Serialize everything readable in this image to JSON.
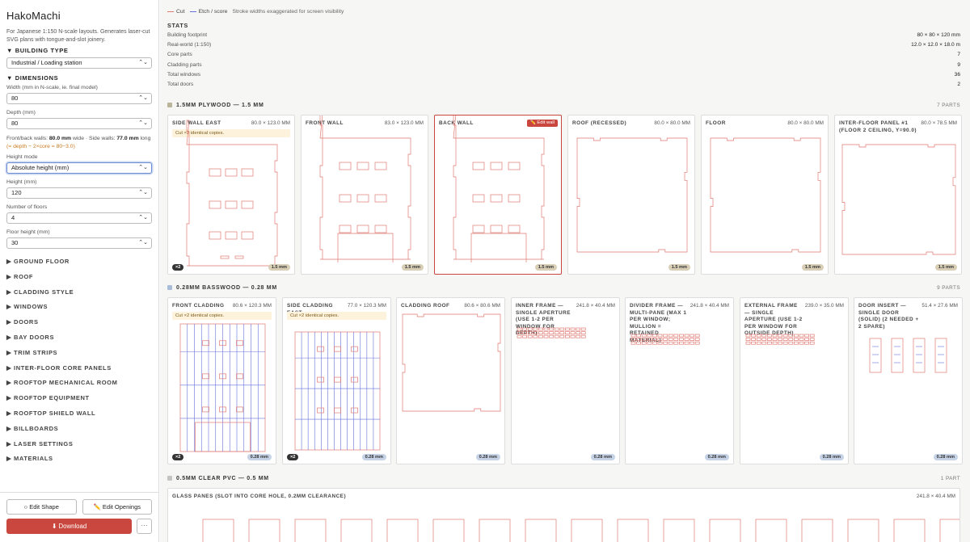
{
  "app": {
    "title": "HakoMachi",
    "description": "For Japanese 1:150 N-scale layouts. Generates laser-cut SVG plans with tongue-and-slot joinery."
  },
  "sidebar": {
    "building_type_label": "▼ BUILDING TYPE",
    "building_type_value": "Industrial / Loading station",
    "dimensions_label": "▼ DIMENSIONS",
    "width_label": "Width (mm in N-scale, ie. final model)",
    "width_value": "80",
    "depth_label": "Depth (mm)",
    "depth_value": "80",
    "walls_note_a": "Front/back walls: ",
    "walls_note_b": "80.0 mm",
    "walls_note_c": " wide · Side walls: ",
    "walls_note_d": "77.0 mm",
    "walls_note_e": " long ",
    "walls_note_f": "(= depth − 2×core = 80−3.0)",
    "height_mode_label": "Height mode",
    "height_mode_value": "Absolute height (mm)",
    "height_label": "Height (mm)",
    "height_value": "120",
    "floors_label": "Number of floors",
    "floors_value": "4",
    "floor_height_label": "Floor height (mm)",
    "floor_height_value": "30",
    "sections": [
      "▶ GROUND FLOOR",
      "▶ ROOF",
      "▶ CLADDING STYLE",
      "▶ WINDOWS",
      "▶ DOORS",
      "▶ BAY DOORS",
      "▶ TRIM STRIPS",
      "▶ INTER-FLOOR CORE PANELS",
      "▶ ROOFTOP MECHANICAL ROOM",
      "▶ ROOFTOP EQUIPMENT",
      "▶ ROOFTOP SHIELD WALL",
      "▶ BILLBOARDS",
      "▶ LASER SETTINGS",
      "▶ MATERIALS"
    ],
    "edit_shape": "○ Edit Shape",
    "edit_openings": "✏️ Edit Openings",
    "download": "⬇ Download",
    "more": "···"
  },
  "legend": {
    "cut": "Cut",
    "etch": "Etch / score",
    "hint": "Stroke widths exaggerated for screen visibility",
    "cut_color": "#e07a72",
    "etch_color": "#6670d8"
  },
  "stats": {
    "title": "STATS",
    "rows": [
      {
        "label": "Building footprint",
        "value": "80 × 80 × 120 mm"
      },
      {
        "label": "Real-world (1:150)",
        "value": "12.0 × 12.0 × 18.0 m"
      },
      {
        "label": "Core parts",
        "value": "7"
      },
      {
        "label": "Cladding parts",
        "value": "9"
      },
      {
        "label": "Total windows",
        "value": "36"
      },
      {
        "label": "Total doors",
        "value": "2"
      }
    ]
  },
  "groups": [
    {
      "title": "1.5MM PLYWOOD — 1.5 MM",
      "count": "7 PARTS",
      "color": "#b9b49a",
      "parts": [
        {
          "name": "SIDE WALL EAST",
          "dims": "80.0 × 123.0 MM",
          "note": "Cut ×2 identical copies.",
          "qty": "×2",
          "badge": "1.5 mm"
        },
        {
          "name": "FRONT WALL",
          "dims": "83.0 × 123.0 MM",
          "badge": "1.5 mm"
        },
        {
          "name": "BACK WALL",
          "dims": "83.0",
          "edit": "✏️ Edit wall",
          "badge": "1.5 mm"
        },
        {
          "name": "ROOF (RECESSED)",
          "dims": "80.0 × 80.0 MM",
          "badge": "1.5 mm"
        },
        {
          "name": "FLOOR",
          "dims": "80.0 × 80.0 MM",
          "badge": "1.5 mm"
        },
        {
          "name": "INTER-FLOOR PANEL #1 (FLOOR 2 CEILING, Y=90.0)",
          "dims": "80.0 × 78.5 MM",
          "badge": "1.5 mm"
        }
      ]
    },
    {
      "title": "0.28MM BASSWOOD — 0.28 MM",
      "count": "9 PARTS",
      "color": "#a9bcd8",
      "parts": [
        {
          "name": "FRONT CLADDING",
          "dims": "80.6 × 120.3 MM",
          "note": "Cut ×2 identical copies.",
          "qty": "×2",
          "badge": "0.28 mm"
        },
        {
          "name": "SIDE CLADDING EAST",
          "dims": "77.0 × 120.3 MM",
          "note": "Cut ×2 identical copies.",
          "qty": "×2",
          "badge": "0.28 mm"
        },
        {
          "name": "CLADDING ROOF",
          "dims": "80.6 × 80.6 MM",
          "badge": "0.28 mm"
        },
        {
          "name": "INNER FRAME — SINGLE APERTURE (USE 1-2 PER WINDOW FOR DEPTH)",
          "dims": "241.8 × 40.4 MM",
          "badge": "0.28 mm"
        },
        {
          "name": "DIVIDER FRAME — MULTI-PANE (MAX 1 PER WINDOW; MULLION = RETAINED MATERIAL)",
          "dims": "241.8 × 40.4 MM",
          "badge": "0.28 mm"
        },
        {
          "name": "EXTERNAL FRAME — SINGLE APERTURE (USE 1-2 PER WINDOW FOR OUTSIDE DEPTH)",
          "dims": "239.0 × 35.0 MM",
          "badge": "0.28 mm"
        },
        {
          "name": "DOOR INSERT — SINGLE DOOR (SOLID) (2 NEEDED + 2 SPARE)",
          "dims": "51.4 × 27.6 MM",
          "badge": "0.28 mm"
        }
      ]
    },
    {
      "title": "0.5MM CLEAR PVC — 0.5 MM",
      "count": "1 PART",
      "color": "#c4c4c4",
      "parts": [
        {
          "name": "GLASS PANES (SLOT INTO CORE HOLE, 0.2MM CLEARANCE)",
          "dims": "241.8 × 40.4 MM"
        }
      ]
    }
  ]
}
